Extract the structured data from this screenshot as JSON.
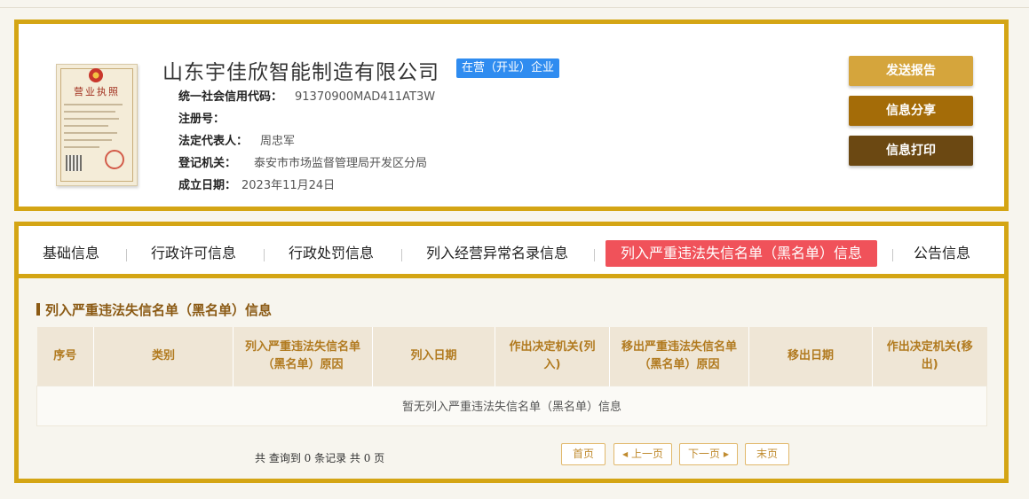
{
  "company": {
    "name": "山东宇佳欣智能制造有限公司",
    "status": "在营（开业）企业",
    "license_title": "营业执照",
    "fields": [
      {
        "label": "统一社会信用代码：",
        "value": "91370900MAD411AT3W"
      },
      {
        "label": "注册号：",
        "value": ""
      },
      {
        "label": "法定代表人：",
        "value": "周忠军"
      },
      {
        "label": "登记机关：",
        "value": "泰安市市场监督管理局开发区分局"
      },
      {
        "label": "成立日期：",
        "value": "2023年11月24日"
      }
    ]
  },
  "actions": {
    "send_report": "发送报告",
    "share": "信息分享",
    "print": "信息打印"
  },
  "tabs": [
    {
      "label": "基础信息",
      "active": false
    },
    {
      "label": "行政许可信息",
      "active": false
    },
    {
      "label": "行政处罚信息",
      "active": false
    },
    {
      "label": "列入经营异常名录信息",
      "active": false
    },
    {
      "label": "列入严重违法失信名单（黑名单）信息",
      "active": true
    },
    {
      "label": "公告信息",
      "active": false
    }
  ],
  "section": {
    "title": "列入严重违法失信名单（黑名单）信息",
    "columns": [
      "序号",
      "类别",
      "列入严重违法失信名单（黑名单）原因",
      "列入日期",
      "作出决定机关(列入)",
      "移出严重违法失信名单（黑名单）原因",
      "移出日期",
      "作出决定机关(移出)"
    ],
    "empty_message": "暂无列入严重违法失信名单（黑名单）信息"
  },
  "pagination": {
    "summary": "共 查询到 0 条记录 共 0 页",
    "first": "首页",
    "prev": "上一页",
    "next": "下一页",
    "last": "末页"
  },
  "colors": {
    "frame": "#d4a514",
    "badge": "#2f8cf0",
    "active_tab": "#f0525a",
    "btn_send": "#d5a53c",
    "btn_share": "#a46c08",
    "btn_print": "#6b4812"
  }
}
